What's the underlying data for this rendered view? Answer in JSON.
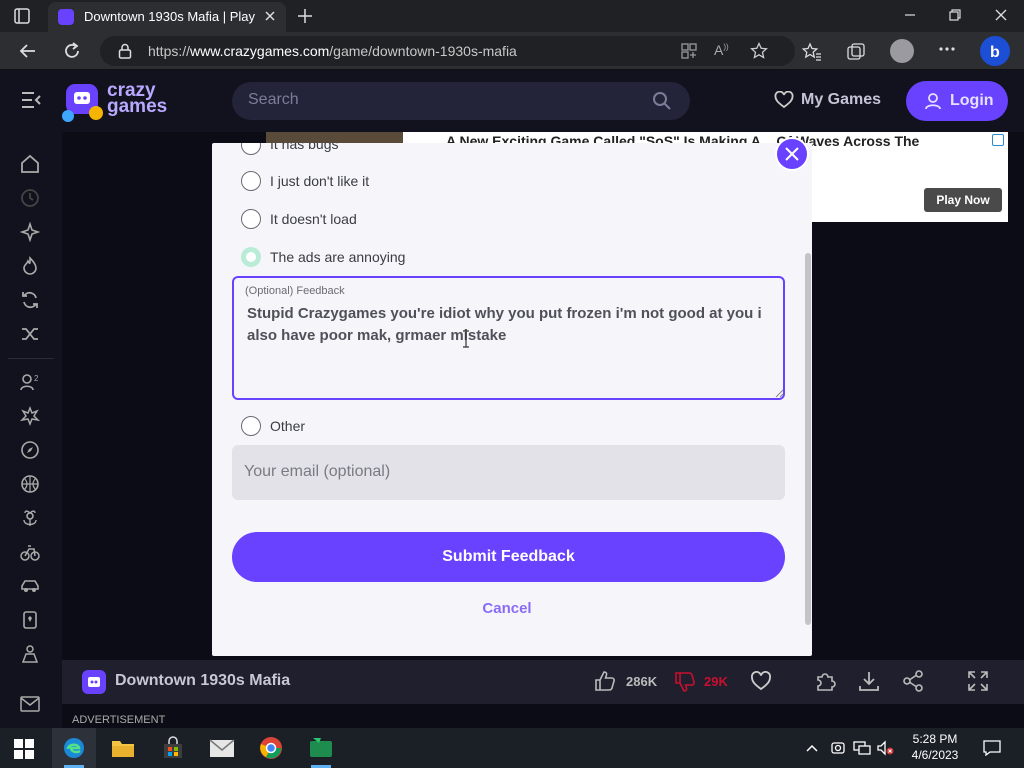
{
  "browser": {
    "tab_title": "Downtown 1930s Mafia | Play",
    "url_prefix": "https://",
    "url_domain": "www.crazygames.com",
    "url_path": "/game/downtown-1930s-mafia"
  },
  "site": {
    "logo_line1": "crazy",
    "logo_line2": "games",
    "search_placeholder": "Search",
    "my_games_label": "My Games",
    "login_label": "Login"
  },
  "ad": {
    "headline": "A New Exciting Game Called \"SoS\" Is Making A... Of Waves Across The",
    "cta": "Play Now"
  },
  "modal": {
    "options": [
      {
        "label": "It has bugs",
        "selected": false
      },
      {
        "label": "I just don't like it",
        "selected": false
      },
      {
        "label": "It doesn't load",
        "selected": false
      },
      {
        "label": "The ads are annoying",
        "selected": true
      }
    ],
    "feedback_label": "(Optional) Feedback",
    "feedback_value": "Stupid Crazygames you're idiot why you put frozen i'm not good at you i also have poor mak, grmaer mistake",
    "other_label": "Other",
    "email_placeholder": "Your email (optional)",
    "submit_label": "Submit Feedback",
    "cancel_label": "Cancel"
  },
  "game_bar": {
    "title": "Downtown 1930s Mafia",
    "likes": "286K",
    "dislikes": "29K"
  },
  "advertisement_label": "ADVERTISEMENT",
  "taskbar": {
    "time": "5:28 PM",
    "date": "4/6/2023"
  },
  "colors": {
    "brand": "#6842ff",
    "selected_radio": "#b9ecd6",
    "dislike": "#c8102e"
  }
}
